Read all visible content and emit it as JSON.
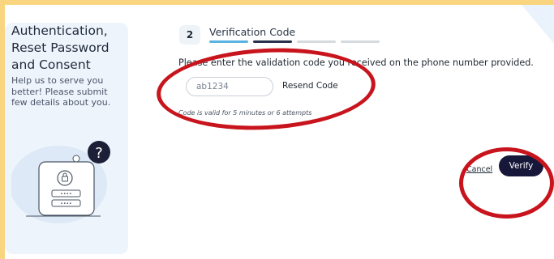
{
  "sidebar": {
    "title": "Authentication, Reset Password and Consent",
    "description": "Help us to serve you better! Please submit few details about you."
  },
  "step": {
    "number": "2",
    "title": "Verification Code",
    "progress_colors": [
      "#5bb3e3",
      "#27304d",
      "#d6dbe0",
      "#d6dbe0"
    ]
  },
  "form": {
    "instruction": "Please enter the validation code you received on the phone number provided.",
    "code_placeholder": "ab1234",
    "resend_label": "Resend Code",
    "validity_note": "Code is valid for 5 minutes or 6 attempts",
    "cancel_label": "Cancel",
    "verify_label": "Verify"
  },
  "colors": {
    "frame": "#f8d57e",
    "sidebar_bg": "#eef4fc",
    "primary_button": "#17173a",
    "annotation": "#c8141c"
  }
}
